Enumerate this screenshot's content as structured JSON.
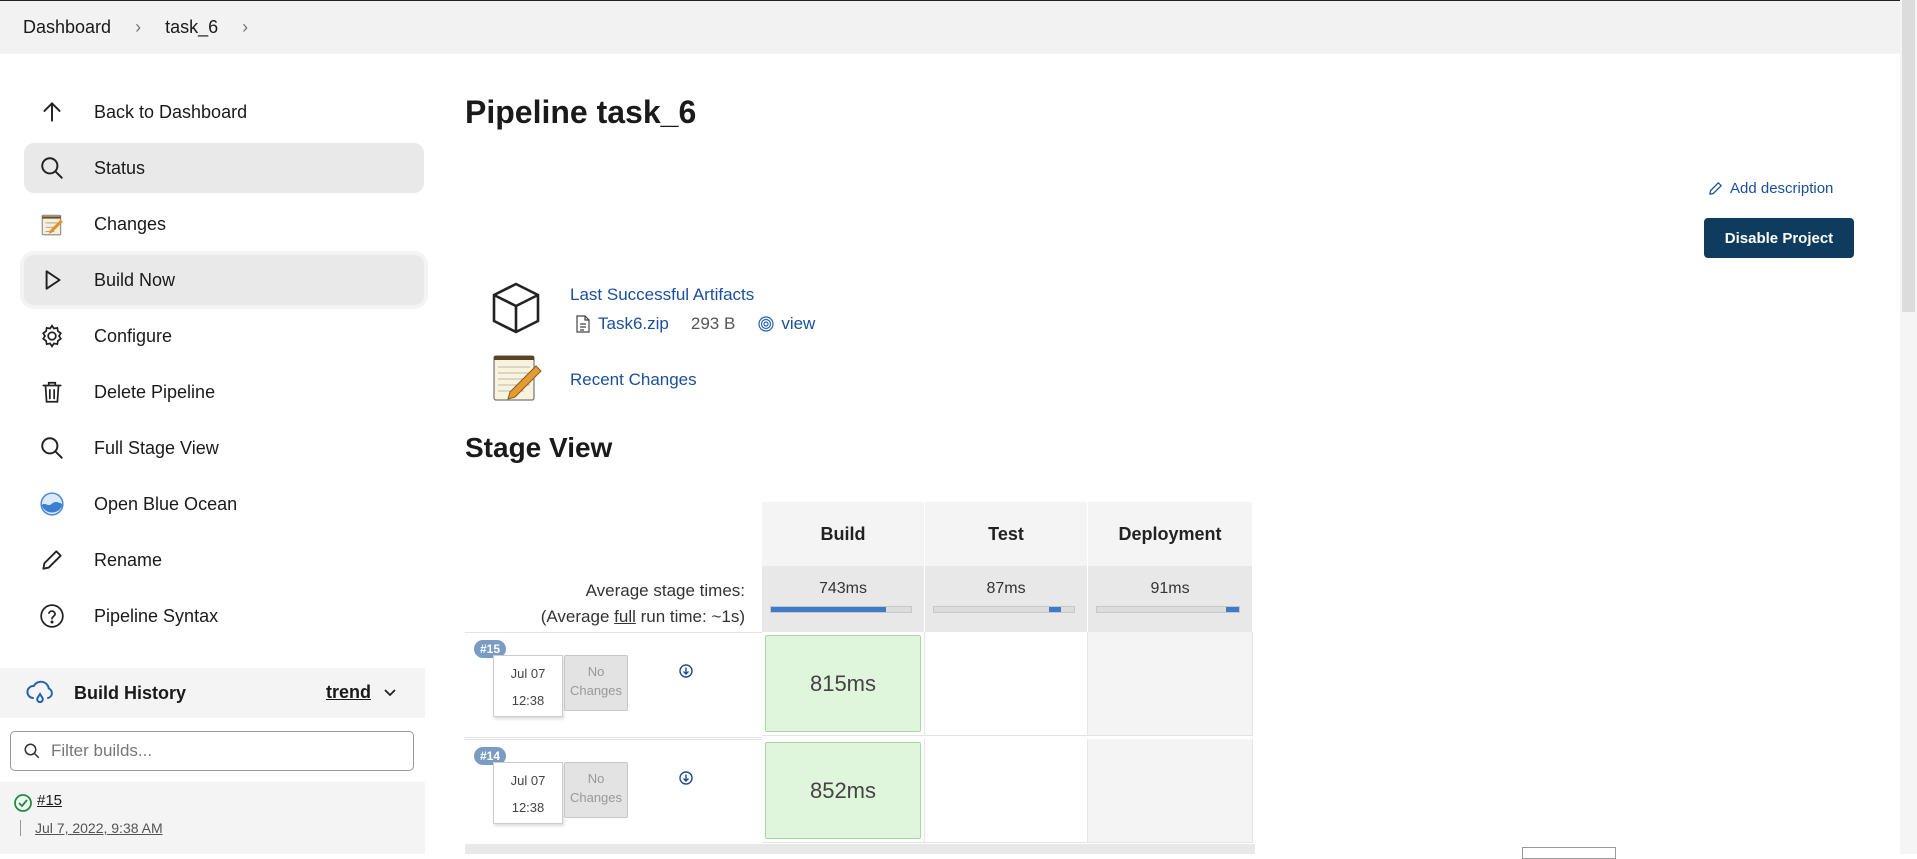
{
  "breadcrumb": {
    "items": [
      "Dashboard",
      "task_6"
    ]
  },
  "sidebar": {
    "items": [
      {
        "label": "Back to Dashboard",
        "icon": "arrow-up-icon"
      },
      {
        "label": "Status",
        "icon": "search-icon"
      },
      {
        "label": "Changes",
        "icon": "notepad-icon"
      },
      {
        "label": "Build Now",
        "icon": "play-icon"
      },
      {
        "label": "Configure",
        "icon": "gear-icon"
      },
      {
        "label": "Delete Pipeline",
        "icon": "trash-icon"
      },
      {
        "label": "Full Stage View",
        "icon": "search-icon"
      },
      {
        "label": "Open Blue Ocean",
        "icon": "blue-ocean-icon"
      },
      {
        "label": "Rename",
        "icon": "pencil-icon"
      },
      {
        "label": "Pipeline Syntax",
        "icon": "help-icon"
      }
    ]
  },
  "build_history": {
    "title": "Build History",
    "trend_label": "trend",
    "filter_placeholder": "Filter builds...",
    "builds": [
      {
        "number": "#15",
        "date": "Jul 7, 2022, 9:38 AM",
        "status": "success"
      }
    ]
  },
  "main": {
    "title": "Pipeline task_6",
    "add_description": "Add description",
    "disable_button": "Disable Project",
    "artifacts": {
      "heading": "Last Successful Artifacts",
      "file_name": "Task6.zip",
      "file_size": "293 B",
      "view_label": "view"
    },
    "recent_changes": "Recent Changes"
  },
  "stage_view": {
    "title": "Stage View",
    "avg_label_line1": "Average stage times:",
    "avg_label_line2_pre": "(Average ",
    "avg_label_line2_full": "full",
    "avg_label_line2_post": " run time: ~1s)",
    "stages": [
      {
        "name": "Build",
        "avg": "743ms",
        "bar_start": 0.0,
        "bar_end": 0.82
      },
      {
        "name": "Test",
        "avg": "87ms",
        "bar_start": 0.82,
        "bar_end": 0.91
      },
      {
        "name": "Deployment",
        "avg": "91ms",
        "bar_start": 0.91,
        "bar_end": 1.0
      }
    ],
    "runs": [
      {
        "badge": "#15",
        "date": "Jul 07",
        "time": "12:38",
        "changes": "No Changes",
        "cells": [
          "815ms",
          "",
          ""
        ]
      },
      {
        "badge": "#14",
        "date": "Jul 07",
        "time": "12:38",
        "changes": "No Changes",
        "cells": [
          "852ms",
          "",
          ""
        ]
      }
    ]
  },
  "colors": {
    "link": "#1b4f9c",
    "primary_button": "#0e3b5e",
    "success_cell": "#dff5dc",
    "progress": "#3f7ac8"
  }
}
